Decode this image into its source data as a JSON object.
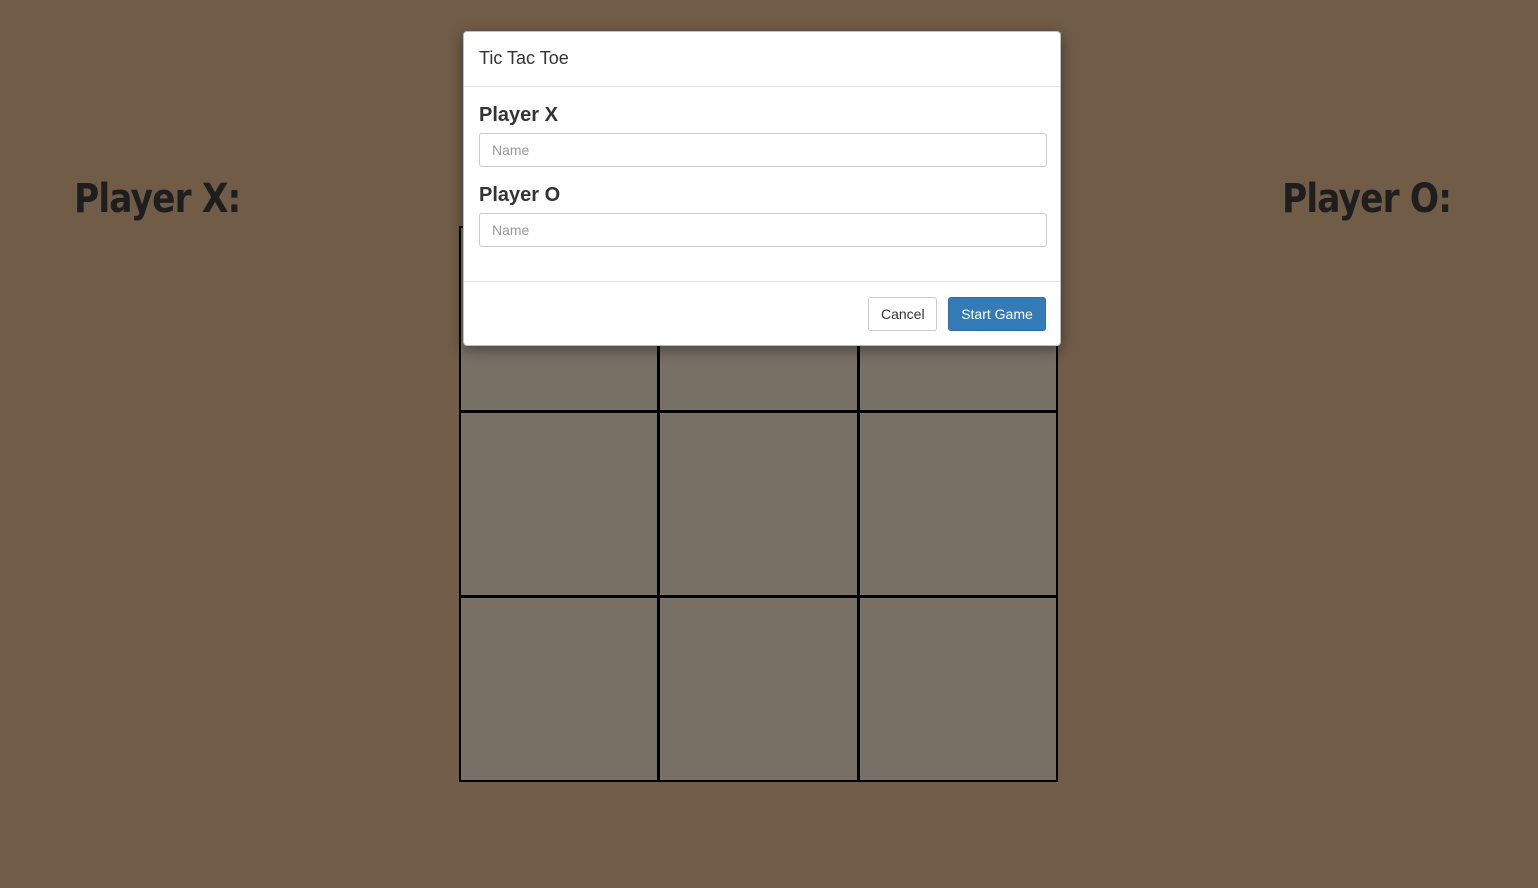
{
  "page": {
    "background_color": "#705c47",
    "board_cell_color": "#797065"
  },
  "scoreboard": {
    "player_x_label": "Player X:",
    "player_o_label": "Player O:"
  },
  "board": {
    "cells": [
      "",
      "",
      "",
      "",
      "",
      "",
      "",
      "",
      ""
    ]
  },
  "modal": {
    "title": "Tic Tac Toe",
    "player_x": {
      "label": "Player X",
      "placeholder": "Name",
      "value": ""
    },
    "player_o": {
      "label": "Player O",
      "placeholder": "Name",
      "value": ""
    },
    "cancel_label": "Cancel",
    "start_label": "Start Game",
    "primary_color": "#337ab7"
  }
}
